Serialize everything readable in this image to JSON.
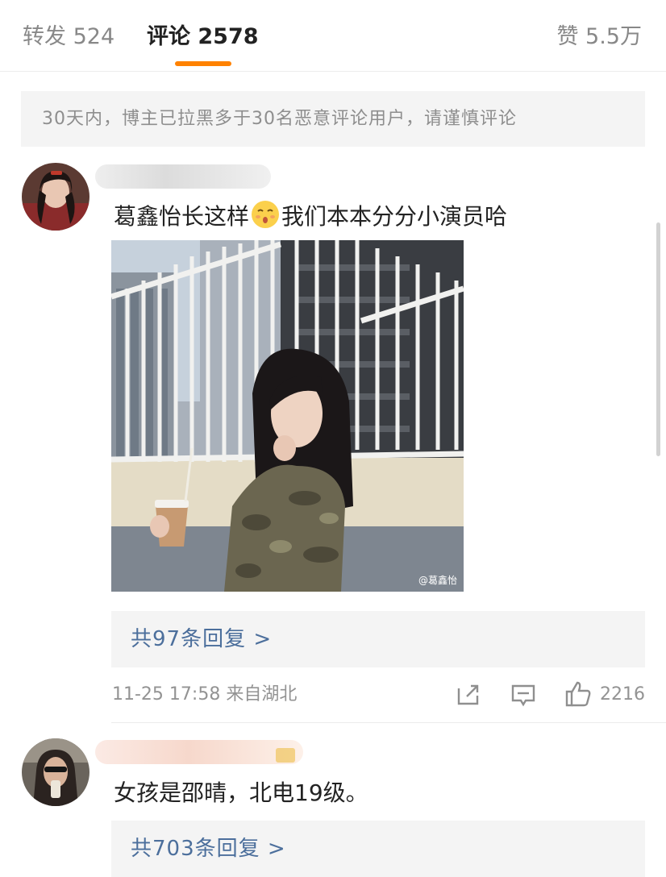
{
  "tabs": {
    "repost": "转发 524",
    "comments": "评论 2578",
    "likes": "赞 5.5万"
  },
  "notice": "30天内，博主已拉黑多于30名恶意评论用户，请谨慎评论",
  "comments": [
    {
      "text_before_emoji": "葛鑫怡长这样",
      "emoji": "kissing-face-emoji",
      "text_after_emoji": "我们本本分分小演员哈",
      "image_watermark": "@葛鑫怡",
      "replies": "共97条回复 >",
      "meta": "11-25 17:58  来自湖北",
      "like_count": "2216"
    },
    {
      "text": "女孩是邵晴，北电19级。",
      "replies": "共703条回复 >"
    }
  ],
  "icons": [
    "share-icon",
    "comment-icon",
    "thumbs-up-icon"
  ],
  "colors": {
    "accent": "#ff8200",
    "link": "#4c6f9c",
    "meta": "#939393"
  }
}
